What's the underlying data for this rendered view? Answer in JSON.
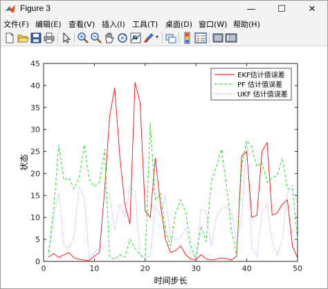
{
  "window": {
    "title": "Figure 3",
    "minimize_label": "—",
    "maximize_label": "☐",
    "close_label": "✕"
  },
  "menu": {
    "items": [
      "文件(F)",
      "编辑(E)",
      "查看(V)",
      "插入(I)",
      "工具(T)",
      "桌面(D)",
      "窗口(W)",
      "帮助(H)"
    ]
  },
  "toolbar": {
    "icons": [
      "new-figure-icon",
      "open-file-icon",
      "save-icon",
      "print-icon",
      "pointer-icon",
      "zoom-in-icon",
      "zoom-out-icon",
      "pan-icon",
      "rotate-3d-icon",
      "data-cursor-icon",
      "brush-icon",
      "link-icon",
      "colorbar-icon",
      "legend-icon",
      "hide-plot-tools-icon",
      "show-plot-tools-icon"
    ]
  },
  "chart_data": {
    "type": "line",
    "title": "",
    "xlabel": "时间步长",
    "ylabel": "状态",
    "xlim": [
      0,
      50
    ],
    "ylim": [
      0,
      45
    ],
    "xticks": [
      0,
      10,
      20,
      30,
      40,
      50
    ],
    "yticks": [
      0,
      5,
      10,
      15,
      20,
      25,
      30,
      35,
      40,
      45
    ],
    "legend_position": "top-right",
    "series": [
      {
        "name": "EKF估计值误差",
        "color": "#ff0000",
        "style": "solid",
        "x": [
          1,
          2,
          3,
          4,
          5,
          6,
          7,
          8,
          9,
          10,
          11,
          12,
          13,
          14,
          15,
          16,
          17,
          18,
          19,
          20,
          21,
          22,
          23,
          24,
          25,
          26,
          27,
          28,
          29,
          30,
          31,
          32,
          33,
          34,
          35,
          36,
          37,
          38,
          39,
          40,
          41,
          42,
          43,
          44,
          45,
          46,
          47,
          48,
          49,
          50
        ],
        "y": [
          1,
          1.8,
          0.9,
          1.5,
          2,
          0.8,
          0.5,
          0.3,
          0.2,
          1.2,
          2,
          16,
          33,
          39.5,
          24,
          13,
          8.5,
          40.7,
          36,
          11.5,
          10,
          23.5,
          13,
          5,
          2,
          2.5,
          3.5,
          1.5,
          0.5,
          0.4,
          1.5,
          0.6,
          0.3,
          0.5,
          0.8,
          0.6,
          0.3,
          1.2,
          24,
          25,
          10,
          10.5,
          25,
          27,
          10.5,
          11,
          13,
          14,
          3.5,
          0.8
        ]
      },
      {
        "name": "PF 估计值误差",
        "color": "#00e000",
        "style": "dashed",
        "x": [
          1,
          2,
          3,
          4,
          5,
          6,
          7,
          8,
          9,
          10,
          11,
          12,
          13,
          14,
          15,
          16,
          17,
          18,
          19,
          20,
          21,
          22,
          23,
          24,
          25,
          26,
          27,
          28,
          29,
          30,
          31,
          32,
          33,
          34,
          35,
          36,
          37,
          38,
          39,
          40,
          41,
          42,
          43,
          44,
          45,
          46,
          47,
          48,
          49,
          50
        ],
        "y": [
          2,
          12,
          26.5,
          18.5,
          19,
          16.5,
          19,
          26.5,
          18.5,
          17,
          18,
          25.5,
          1,
          0.5,
          1.5,
          1,
          5,
          3,
          1.5,
          0.5,
          31.5,
          14,
          15.5,
          7,
          3.5,
          11,
          14,
          11,
          3.5,
          0.5,
          8,
          4.5,
          18,
          21.5,
          25.5,
          17.5,
          7,
          1.5,
          22,
          27.5,
          26,
          21.5,
          22.5,
          18,
          19,
          19.5,
          23.5,
          16.5,
          16.5,
          5
        ]
      },
      {
        "name": "UKF 估计值误差",
        "color": "#7b7bff",
        "style": "dotted",
        "x": [
          1,
          2,
          3,
          4,
          5,
          6,
          7,
          8,
          9,
          10,
          11,
          12,
          13,
          14,
          15,
          16,
          17,
          18,
          19,
          20,
          21,
          22,
          23,
          24,
          25,
          26,
          27,
          28,
          29,
          30,
          31,
          32,
          33,
          34,
          35,
          36,
          37,
          38,
          39,
          40,
          41,
          42,
          43,
          44,
          45,
          46,
          47,
          48,
          49,
          50
        ],
        "y": [
          1,
          10,
          15.5,
          3.5,
          3,
          5.5,
          17,
          14.5,
          0.5,
          2,
          3,
          16,
          15.5,
          7,
          13,
          10,
          17,
          16,
          1.5,
          1,
          1,
          12.5,
          10.5,
          15,
          5,
          5,
          5.5,
          7.5,
          2,
          0.5,
          12,
          11.5,
          3.5,
          10,
          12,
          12.5,
          11.5,
          4,
          10,
          27,
          3,
          1,
          11,
          13,
          4.5,
          1.5,
          5,
          15.5,
          17.5,
          13
        ]
      }
    ]
  }
}
